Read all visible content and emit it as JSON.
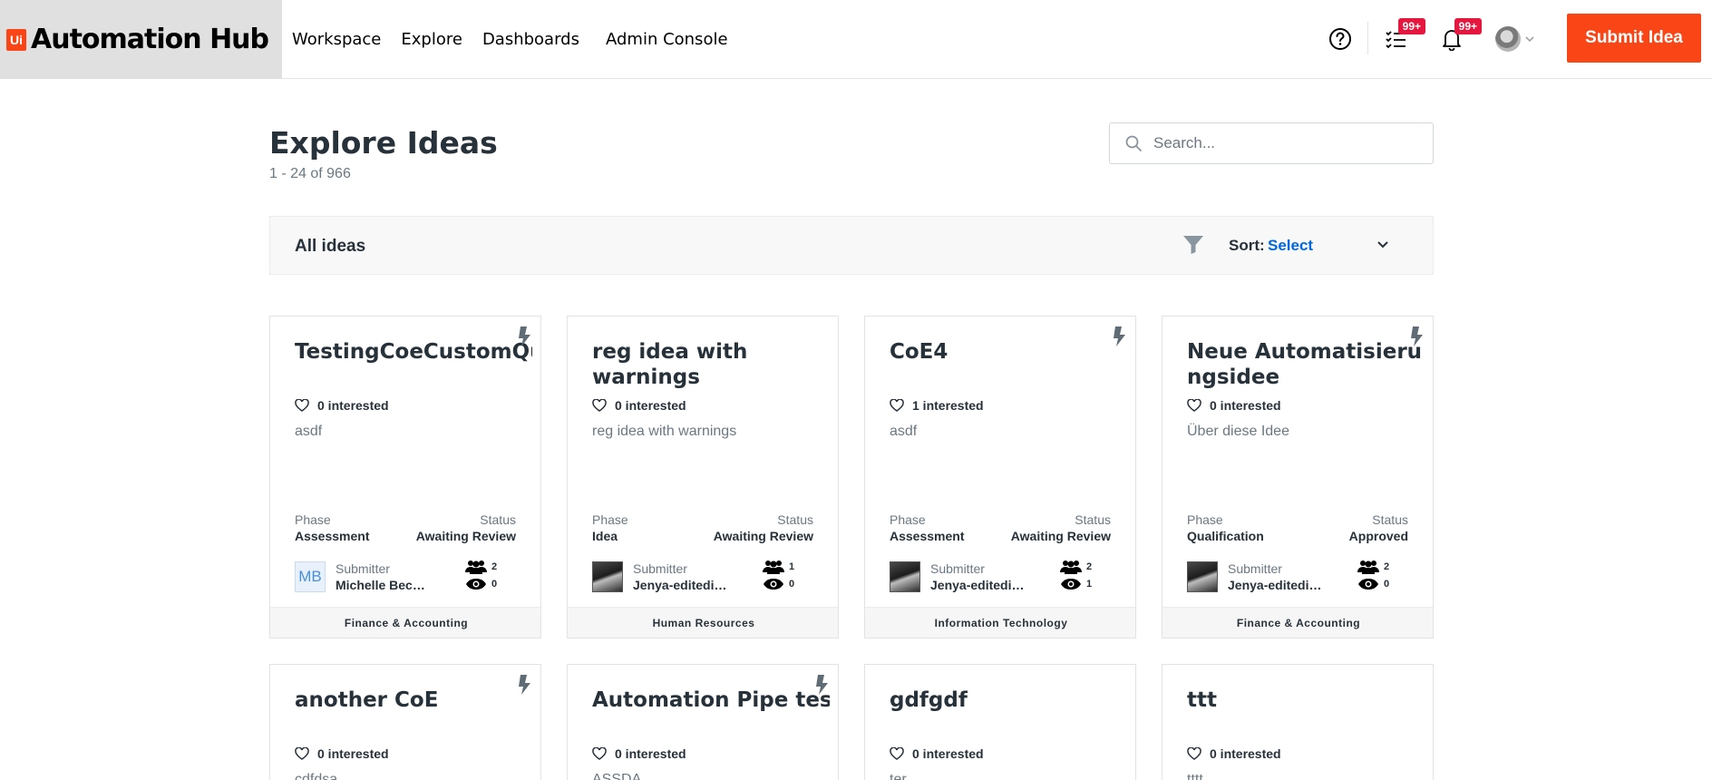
{
  "header": {
    "logo_mark": "Ui",
    "logo_text": "Automation Hub",
    "nav": [
      "Workspace",
      "Explore",
      "Dashboards",
      "Admin Console"
    ],
    "tasks_badge": "99+",
    "notifications_badge": "99+",
    "submit_label": "Submit Idea"
  },
  "page": {
    "title": "Explore Ideas",
    "count": "1 - 24 of 966",
    "search_placeholder": "Search..."
  },
  "filter_bar": {
    "label": "All ideas",
    "sort_label": "Sort:",
    "sort_value": "Select"
  },
  "labels": {
    "phase": "Phase",
    "status": "Status",
    "submitter": "Submitter"
  },
  "cards": [
    {
      "title": "TestingCoeCustomQu",
      "interested": "0 interested",
      "description": "asdf",
      "phase": "Assessment",
      "status": "Awaiting Review",
      "avatar": "MB",
      "submitter": "Michelle Becerra",
      "collaborators": "2",
      "views": "0",
      "category": "Finance & Accounting",
      "bolt": true
    },
    {
      "title": "reg idea with warnings",
      "interested": "0 interested",
      "description": "reg idea with warnings",
      "phase": "Idea",
      "status": "Awaiting Review",
      "avatar": "",
      "submitter": "Jenya-editedit Vas-...",
      "collaborators": "1",
      "views": "0",
      "category": "Human Resources",
      "bolt": false
    },
    {
      "title": "CoE4",
      "interested": "1 interested",
      "description": "asdf",
      "phase": "Assessment",
      "status": "Awaiting Review",
      "avatar": "",
      "submitter": "Jenya-editedit Vas-...",
      "collaborators": "2",
      "views": "1",
      "category": "Information Technology",
      "bolt": true
    },
    {
      "title": "Neue Automatisierungsidee",
      "interested": "0 interested",
      "description": "Über diese Idee",
      "phase": "Qualification",
      "status": "Approved",
      "avatar": "",
      "submitter": "Jenya-editedit Vas-...",
      "collaborators": "2",
      "views": "0",
      "category": "Finance & Accounting",
      "bolt": true
    },
    {
      "title": "another CoE",
      "interested": "0 interested",
      "description": "cdfdsa",
      "bolt": true
    },
    {
      "title": "Automation Pipe test",
      "interested": "0 interested",
      "description": "ASSDA",
      "bolt": true
    },
    {
      "title": "gdfgdf",
      "interested": "0 interested",
      "description": "ter",
      "bolt": false
    },
    {
      "title": "ttt",
      "interested": "0 interested",
      "description": "tttt",
      "bolt": false
    }
  ]
}
